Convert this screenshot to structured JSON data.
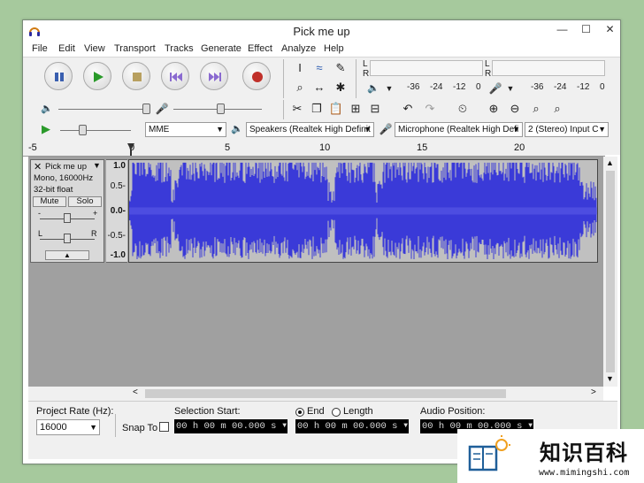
{
  "window": {
    "title": "Pick me up",
    "minimize": "—",
    "maximize": "☐",
    "close": "✕"
  },
  "menu": [
    "File",
    "Edit",
    "View",
    "Transport",
    "Tracks",
    "Generate",
    "Effect",
    "Analyze",
    "Help"
  ],
  "meters": {
    "ch_l": "L",
    "ch_r": "R",
    "scale": [
      "-36",
      "-24",
      "-12",
      "0"
    ]
  },
  "devices": {
    "host": "MME",
    "output": "Speakers (Realtek High Definit",
    "input": "Microphone (Realtek High Defi",
    "channels": "2 (Stereo) Input C"
  },
  "ruler": [
    "-5",
    "0",
    "5",
    "10",
    "15",
    "20"
  ],
  "track": {
    "name": "Pick me up",
    "info1": "Mono, 16000Hz",
    "info2": "32-bit float",
    "mute": "Mute",
    "solo": "Solo",
    "gain_minus": "-",
    "gain_plus": "+",
    "pan_l": "L",
    "pan_r": "R",
    "scale": [
      "1.0",
      "0.5-",
      "0.0-",
      "-0.5-",
      "-1.0"
    ]
  },
  "status": {
    "rate_label": "Project Rate (Hz):",
    "rate_value": "16000",
    "snap_label": "Snap To",
    "sel_start_label": "Selection Start:",
    "end_label": "End",
    "length_label": "Length",
    "audio_pos_label": "Audio Position:",
    "time_value": "00 h 00 m 00.000 s"
  },
  "watermark": {
    "cn": "知识百科",
    "url": "www.mimingshi.com"
  },
  "colors": {
    "wave": "#3a3ad8",
    "wave_bg": "#c0c0c0",
    "page_bg": "#a6c99d"
  }
}
